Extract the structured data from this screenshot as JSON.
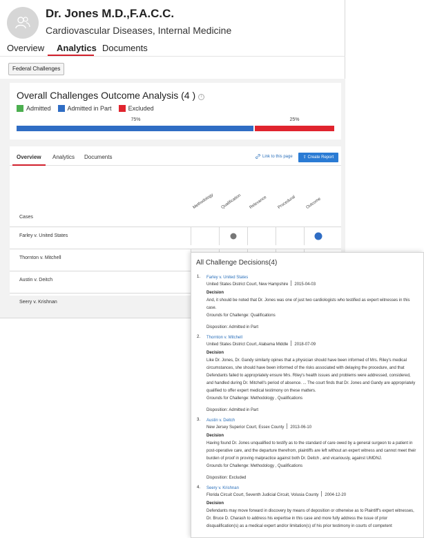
{
  "profile": {
    "name": "Dr. Jones M.D.,F.A.C.C.",
    "specialty": "Cardiovascular Diseases, Internal Medicine"
  },
  "top_tabs": [
    {
      "label": "Overview",
      "active": false
    },
    {
      "label": "Analytics",
      "active": true
    },
    {
      "label": "Documents",
      "active": false
    }
  ],
  "filter_chip": "Federal Challenges",
  "outcome": {
    "title": "Overall Challenges Outcome Analysis (4 )",
    "legend": [
      {
        "label": "Admitted",
        "color": "#4caf50"
      },
      {
        "label": "Admitted in Part",
        "color": "#2f6dc4"
      },
      {
        "label": "Excluded",
        "color": "#e0242e"
      }
    ],
    "segments": [
      {
        "label": "75%",
        "fraction": 0.75,
        "color": "#2f6dc4"
      },
      {
        "label": "25%",
        "fraction": 0.25,
        "color": "#e0242e"
      }
    ]
  },
  "sub_tabs": [
    {
      "label": "Overview",
      "active": true
    },
    {
      "label": "Analytics",
      "active": false
    },
    {
      "label": "Documents",
      "active": false
    }
  ],
  "link_to_page": "Link to this page",
  "create_report": "Create Report",
  "matrix": {
    "cases_header": "Cases",
    "columns": [
      "Methodology",
      "Qualification",
      "Relevance",
      "Procedural",
      "Outcome"
    ],
    "rows": [
      {
        "case": "Farley v. United States",
        "marks": [
          "",
          "gray",
          "",
          "",
          "blue"
        ]
      },
      {
        "case": "Thornton v. Mitchell",
        "marks": [
          "gray",
          "gray",
          "",
          "",
          "blue"
        ]
      },
      {
        "case": "Austin v. Deitch",
        "marks": [
          "",
          "",
          "",
          "",
          ""
        ]
      },
      {
        "case": "Seery v. Krishnan",
        "marks": [
          "",
          "",
          "",
          "",
          ""
        ]
      }
    ]
  },
  "decisions": {
    "title": "All Challenge Decisions(4)",
    "decision_label": "Decision",
    "items": [
      {
        "num": "1.",
        "case": "Farley v. United States",
        "court": "United States District Court, New Hampshire",
        "date": "2015-04-03",
        "text": "And, it should be noted that Dr. Jones was one of just two cardiologists who testified as expert witnesses in this case.",
        "grounds": "Grounds for Challenge: Qualifications",
        "disposition": "Disposition: Admitted in Part"
      },
      {
        "num": "2.",
        "case": "Thornton v. Mitchell",
        "court": "United States District Court, Alabama Middle",
        "date": "2018-07-09",
        "text": "Like Dr. Jones, Dr. Gandy similarly opines that a physician should have been informed of Mrs. Riley's medical circumstances, she should have been informed of the risks associated with delaying the procedure, and that Defendants failed to appropriately ensure Mrs. Riley's health issues and problems were addressed, considered, and handled during Dr. Mitchell's period of absence. ... The court finds that Dr. Jones and Gandy are appropriately qualified to offer expert medical testimony on these matters.",
        "grounds": "Grounds for Challenge: Methodology , Qualifications",
        "disposition": "Disposition: Admitted in Part"
      },
      {
        "num": "3.",
        "case": "Austin v. Deitch",
        "court": "New Jersey Superior Court, Essex County",
        "date": "2013-06-10",
        "text": "Having found Dr. Jones unqualified to testify as to the standard of care owed by a general surgeon to a patient in post-operative care, and the departure therefrom, plaintiffs are left without an expert witness and cannot meet their burden of proof in proving malpractice against both Dr. Deitch , and vicariously, against UMDNJ.",
        "grounds": "Grounds for Challenge: Methodology , Qualifications",
        "disposition": "Disposition: Excluded"
      },
      {
        "num": "4.",
        "case": "Seery v. Krishnan",
        "court": "Florida Circuit Court, Seventh Judicial Circuit, Volusia County",
        "date": "2004-12-20",
        "text": "Defendants may move forward in discovery by means of deposition or otherwise as to Plaintiff's expert witnesses, Dr. Bruce D. Charash to address his expertise in this case and more fully address the issue of prior disqualification(s) as a medical expert and/or limitation(s) of his prior testimony in courts of competent",
        "grounds": "",
        "disposition": ""
      }
    ]
  }
}
